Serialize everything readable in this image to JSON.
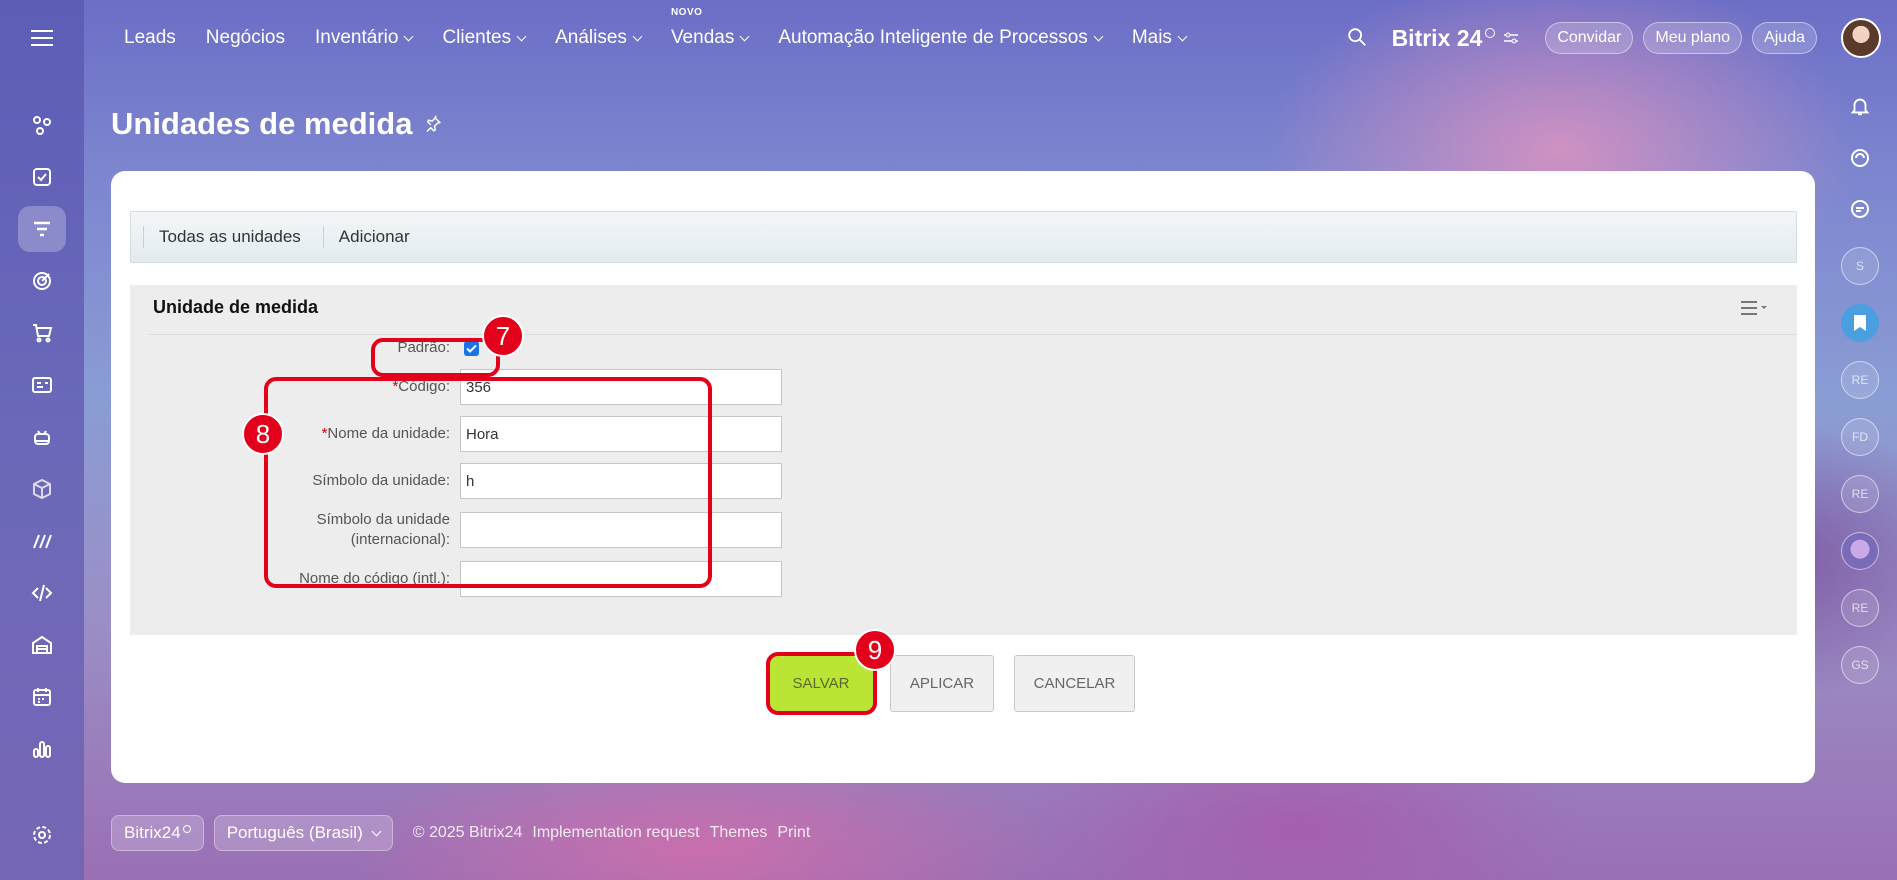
{
  "topbar": {
    "menu": [
      {
        "label": "Leads",
        "dropdown": false
      },
      {
        "label": "Negócios",
        "dropdown": false
      },
      {
        "label": "Inventário",
        "dropdown": true
      },
      {
        "label": "Clientes",
        "dropdown": true
      },
      {
        "label": "Análises",
        "dropdown": true
      },
      {
        "label": "Vendas",
        "dropdown": true,
        "badge": "NOVO"
      },
      {
        "label": "Automação Inteligente de Processos",
        "dropdown": true
      },
      {
        "label": "Mais",
        "dropdown": true
      }
    ],
    "brand": "Bitrix 24",
    "buttons": {
      "invite": "Convidar",
      "plan": "Meu plano",
      "help": "Ajuda"
    }
  },
  "page": {
    "title": "Unidades de medida"
  },
  "toolbar": {
    "all_units": "Todas as unidades",
    "add": "Adicionar"
  },
  "form": {
    "heading": "Unidade de medida",
    "fields": {
      "default": {
        "label": "Padrão:",
        "checked": true
      },
      "code": {
        "label": "Código:",
        "value": "356"
      },
      "name": {
        "label": "Nome da unidade:",
        "value": "Hora"
      },
      "symbol": {
        "label": "Símbolo da unidade:",
        "value": "h"
      },
      "symbol_intl": {
        "label_line1": "Símbolo da unidade",
        "label_line2": "(internacional):",
        "value": ""
      },
      "code_intl": {
        "label": "Nome do código (intl.):",
        "value": ""
      }
    },
    "buttons": {
      "save": "SALVAR",
      "apply": "APLICAR",
      "cancel": "CANCELAR"
    }
  },
  "annotations": {
    "m7": "7",
    "m8": "8",
    "m9": "9"
  },
  "rightrail": {
    "avatars": [
      "S",
      "RE",
      "RE",
      "FD",
      "RE",
      "RE",
      "RE",
      "GS"
    ]
  },
  "footer": {
    "brand": "Bitrix24",
    "language": "Português (Brasil)",
    "copyright": "© 2025 Bitrix24",
    "links": [
      "Implementation request",
      "Themes",
      "Print"
    ]
  },
  "colors": {
    "accent_save": "#bbe535",
    "annotation": "#e3001b",
    "checkbox": "#1a73e8"
  }
}
